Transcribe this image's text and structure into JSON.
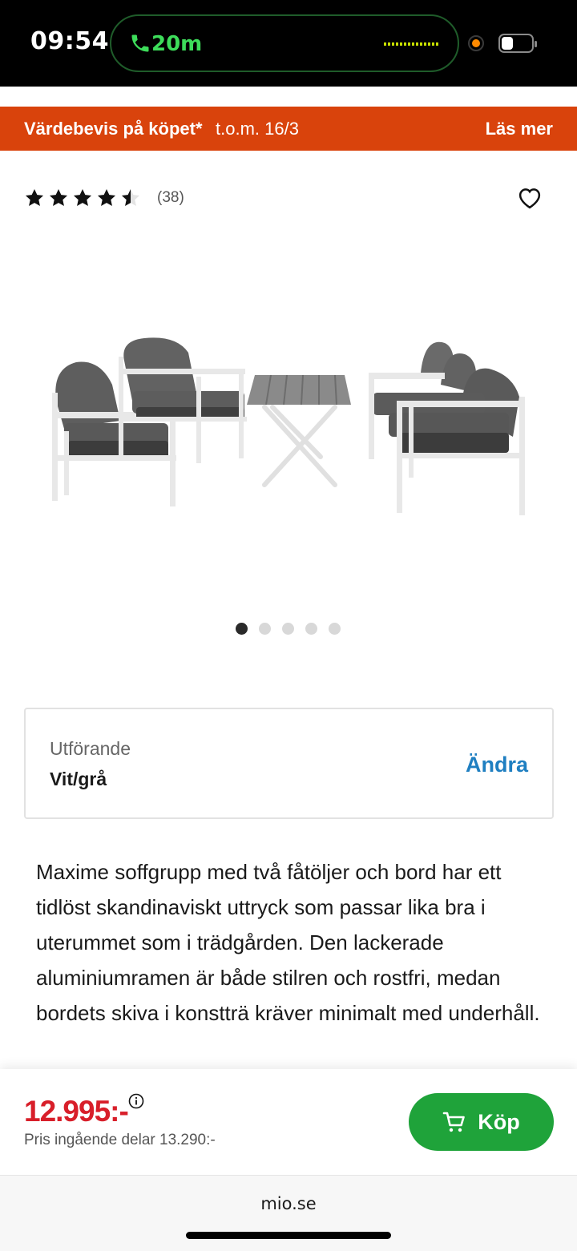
{
  "status_bar": {
    "time": "09:54",
    "call_duration": "20m"
  },
  "promo": {
    "title": "Värdebevis på köpet*",
    "date": "t.o.m. 16/3",
    "link": "Läs mer",
    "color": "#d9430c"
  },
  "rating": {
    "stars": 4.5,
    "max_stars": 5,
    "count": "(38)"
  },
  "carousel": {
    "total": 5,
    "active_index": 0
  },
  "variant": {
    "label": "Utförande",
    "value": "Vit/grå",
    "change": "Ändra"
  },
  "description": "Maxime soffgrupp med två fåtöljer och bord har ett tidlöst skandinaviskt uttryck som passar lika bra i uterummet som i trädgården. Den lackerade aluminiumramen är både stilren och rostfri, medan bordets skiva i konstträ kräver minimalt med underhåll.",
  "buy_bar": {
    "price": "12.995:-",
    "price_sub": "Pris ingående delar 13.290:-",
    "buy_label": "Köp",
    "price_color": "#d81f2a",
    "button_color": "#1fa33a"
  },
  "browser": {
    "url": "mio.se"
  },
  "icons": {
    "call": "phone-icon",
    "heart": "heart-icon",
    "info": "info-icon",
    "cart": "cart-icon",
    "star": "star-icon"
  }
}
